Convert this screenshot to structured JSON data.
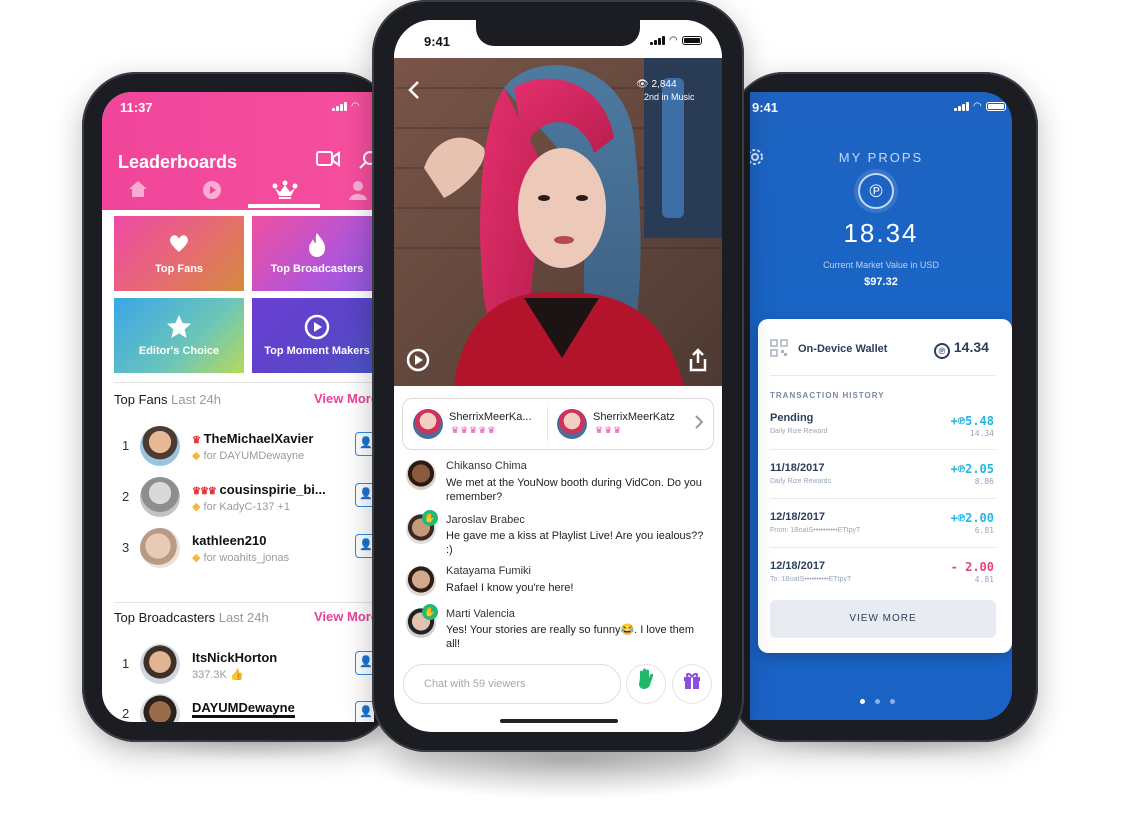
{
  "left": {
    "status_time": "11:37",
    "title": "Leaderboards",
    "tiles": [
      {
        "label": "Top Fans",
        "icon": "hands-heart-icon"
      },
      {
        "label": "Top Broadcasters",
        "icon": "flame-icon"
      },
      {
        "label": "Editor's Choice",
        "icon": "star-icon"
      },
      {
        "label": "Top Moment Makers",
        "icon": "play-circle-icon"
      }
    ],
    "top_fans": {
      "title": "Top Fans",
      "period": "Last 24h",
      "view_more": "View More",
      "rows": [
        {
          "rank": "1",
          "name": "TheMichaelXavier",
          "sub": "for DAYUMDewayne",
          "crowns": "♛"
        },
        {
          "rank": "2",
          "name": "cousinspirie_bi...",
          "sub": "for KadyC-137 +1",
          "crowns": "♛♛♛"
        },
        {
          "rank": "3",
          "name": "kathleen210",
          "sub": "for woahits_jonas",
          "crowns": ""
        }
      ]
    },
    "top_broadcasters": {
      "title": "Top Broadcasters",
      "period": "Last 24h",
      "view_more": "View More",
      "rows": [
        {
          "rank": "1",
          "name": "ItsNickHorton",
          "sub": "337.3K"
        },
        {
          "rank": "2",
          "name": "DAYUMDewayne",
          "sub": ""
        }
      ]
    },
    "colors": {
      "header": "#f0459a",
      "accent": "#e8439b"
    }
  },
  "center": {
    "status_time": "9:41",
    "viewers": "2,844",
    "category": "2nd in Music",
    "guests": [
      {
        "name": "SherrixMeerKa...",
        "crowns": "♛♛♛♛♛"
      },
      {
        "name": "SherrixMeerKatz",
        "crowns": "♛♛♛"
      }
    ],
    "messages": [
      {
        "name": "Chikanso Chima",
        "text": "We met at the YouNow booth during VidCon. Do you remember?",
        "badge": false
      },
      {
        "name": "Jaroslav Brabec",
        "text": "He gave me a kiss at Playlist Live! Are you iealous?? :)",
        "badge": true
      },
      {
        "name": "Katayama Fumiki",
        "text": "Rafael I know you're here!",
        "badge": false
      },
      {
        "name": "Marti Valencia",
        "text": "Yes! Your stories are really so funny😂. I love them all!",
        "badge": true
      }
    ],
    "chat_placeholder": "Chat with 59 viewers"
  },
  "right": {
    "status_time": "9:41",
    "title": "MY PROPS",
    "value": "18.34",
    "value_caption": "Current Market Value in USD",
    "usd": "$97.32",
    "wallet_label": "On-Device Wallet",
    "wallet_balance": "14.34",
    "history_title": "TRANSACTION HISTORY",
    "transactions": [
      {
        "date": "Pending",
        "sub": "Daily Rize Reward",
        "amount": "+℗5.48",
        "balance": "14.34",
        "positive": true
      },
      {
        "date": "11/18/2017",
        "sub": "Daily Rize Rewards",
        "amount": "+℗2.05",
        "balance": "8.86",
        "positive": true
      },
      {
        "date": "12/18/2017",
        "sub": "From: 1BoatS••••••••••ETtpyT",
        "amount": "+℗2.00",
        "balance": "6.81",
        "positive": true
      },
      {
        "date": "12/18/2017",
        "sub": "To: 1BoatS••••••••••ETtpyT",
        "amount": "- 2.00",
        "balance": "4.81",
        "positive": false
      }
    ],
    "view_more": "VIEW MORE",
    "colors": {
      "positive": "#22b5e8",
      "negative": "#e8437b",
      "bg": "#1764c7"
    }
  }
}
